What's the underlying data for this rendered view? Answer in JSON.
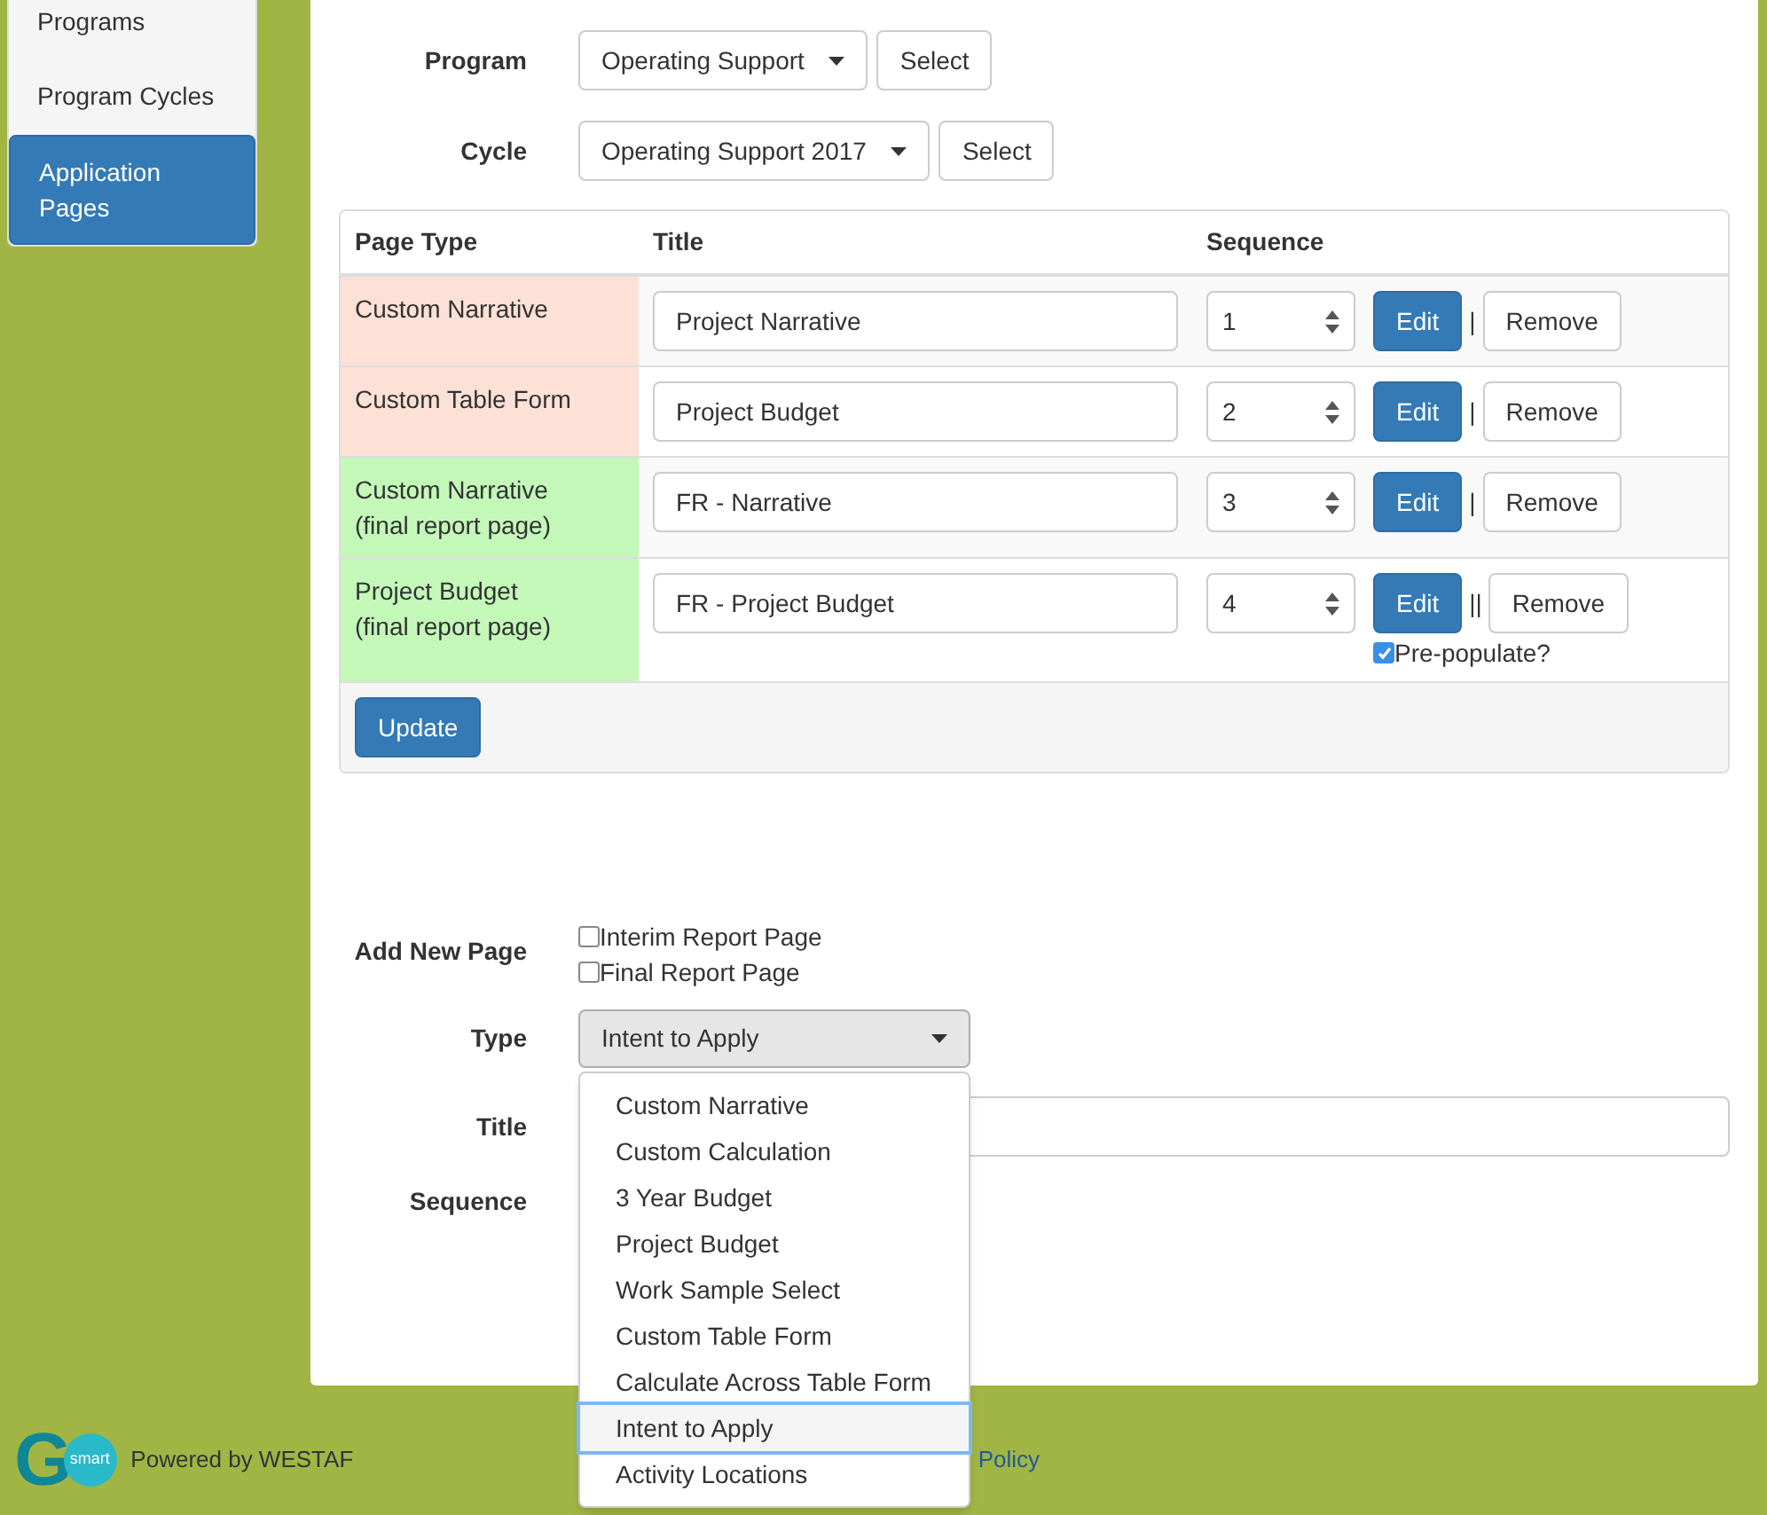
{
  "sidebar": {
    "items": [
      {
        "label": "Programs",
        "selected": false
      },
      {
        "label": "Program Cycles",
        "selected": false
      },
      {
        "label": "Application Pages",
        "selected": true
      }
    ]
  },
  "filters": [
    {
      "label": "Program",
      "value": "Operating Support",
      "button": "Select"
    },
    {
      "label": "Cycle",
      "value": "Operating Support 2017",
      "button": "Select"
    }
  ],
  "table": {
    "columns": [
      "Page Type",
      "Title",
      "Sequence"
    ],
    "rows": [
      {
        "page_type": "Custom Narrative",
        "final_report": false,
        "title": "Project Narrative",
        "sequence": "1",
        "edit": "Edit",
        "separator": "|",
        "remove": "Remove"
      },
      {
        "page_type": "Custom Table Form",
        "final_report": false,
        "title": "Project Budget",
        "sequence": "2",
        "edit": "Edit",
        "separator": "|",
        "remove": "Remove"
      },
      {
        "page_type": "Custom Narrative",
        "type_note": "(final report page)",
        "final_report": true,
        "title": "FR - Narrative",
        "sequence": "3",
        "edit": "Edit",
        "separator": "|",
        "remove": "Remove"
      },
      {
        "page_type": "Project Budget",
        "type_note": "(final report page)",
        "final_report": true,
        "title": "FR - Project Budget",
        "sequence": "4",
        "edit": "Edit",
        "separator": "||",
        "remove": "Remove",
        "prepopulate": {
          "label": "Pre-populate?",
          "checked": true
        }
      }
    ],
    "update_button": "Update"
  },
  "add_new": {
    "label": "Add New Page",
    "options": [
      {
        "label": "Interim Report Page",
        "checked": false
      },
      {
        "label": "Final Report Page",
        "checked": false
      }
    ],
    "type_label": "Type",
    "type_value": "Intent to Apply",
    "type_menu": [
      {
        "label": "Custom Narrative",
        "selected": false
      },
      {
        "label": "Custom Calculation",
        "selected": false
      },
      {
        "label": "3 Year Budget",
        "selected": false
      },
      {
        "label": "Project Budget",
        "selected": false
      },
      {
        "label": "Work Sample Select",
        "selected": false
      },
      {
        "label": "Custom Table Form",
        "selected": false
      },
      {
        "label": "Calculate Across Table Form",
        "selected": false
      },
      {
        "label": "Intent to Apply",
        "selected": true
      },
      {
        "label": "Activity Locations",
        "selected": false
      }
    ],
    "title_label": "Title",
    "sequence_label": "Sequence"
  },
  "footer": {
    "logo_letter": "G",
    "logo_small": "smart",
    "powered": "Powered by WESTAF",
    "link": "Policy"
  }
}
